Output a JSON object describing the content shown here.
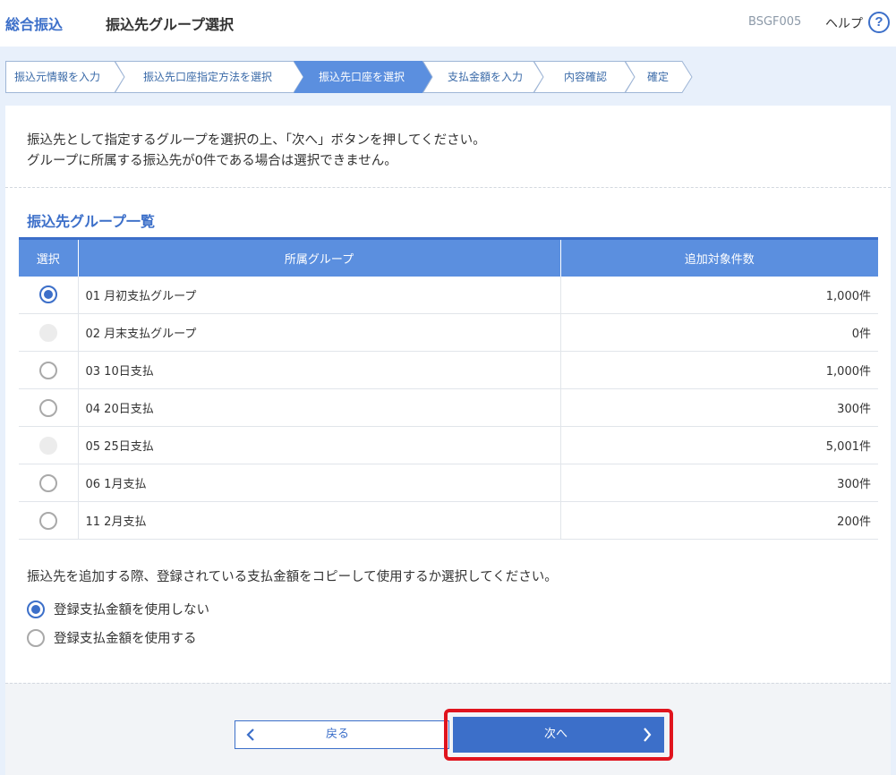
{
  "header": {
    "brand": "総合振込",
    "title": "振込先グループ選択",
    "screen_id": "BSGF005",
    "help_label": "ヘルプ",
    "help_icon": "?"
  },
  "steps": [
    {
      "label": "振込元情報を入力",
      "active": false
    },
    {
      "label": "振込先口座指定方法を選択",
      "active": false
    },
    {
      "label": "振込先口座を選択",
      "active": true
    },
    {
      "label": "支払金額を入力",
      "active": false
    },
    {
      "label": "内容確認",
      "active": false
    },
    {
      "label": "確定",
      "active": false
    }
  ],
  "instructions": {
    "line1": "振込先として指定するグループを選択の上、「次へ」ボタンを押してください。",
    "line2": "グループに所属する振込先が0件である場合は選択できません。"
  },
  "section_title": "振込先グループ一覧",
  "table": {
    "headers": {
      "select": "選択",
      "group": "所属グループ",
      "count": "追加対象件数"
    },
    "rows": [
      {
        "group": "01 月初支払グループ",
        "count": "1,000件",
        "state": "checked"
      },
      {
        "group": "02 月末支払グループ",
        "count": "0件",
        "state": "disabled"
      },
      {
        "group": "03 10日支払",
        "count": "1,000件",
        "state": "unchecked"
      },
      {
        "group": "04 20日支払",
        "count": "300件",
        "state": "unchecked"
      },
      {
        "group": "05 25日支払",
        "count": "5,001件",
        "state": "disabled"
      },
      {
        "group": "06 1月支払",
        "count": "300件",
        "state": "unchecked"
      },
      {
        "group": "11 2月支払",
        "count": "200件",
        "state": "unchecked"
      }
    ]
  },
  "copy_option": {
    "question": "振込先を追加する際、登録されている支払金額をコピーして使用するか選択してください。",
    "option_no": "登録支払金額を使用しない",
    "option_yes": "登録支払金額を使用する",
    "selected": "no"
  },
  "buttons": {
    "back": "戻る",
    "next": "次へ"
  },
  "colors": {
    "accent": "#3c6fc9",
    "header_row": "#5b8fdf",
    "highlight": "#e0141e"
  }
}
